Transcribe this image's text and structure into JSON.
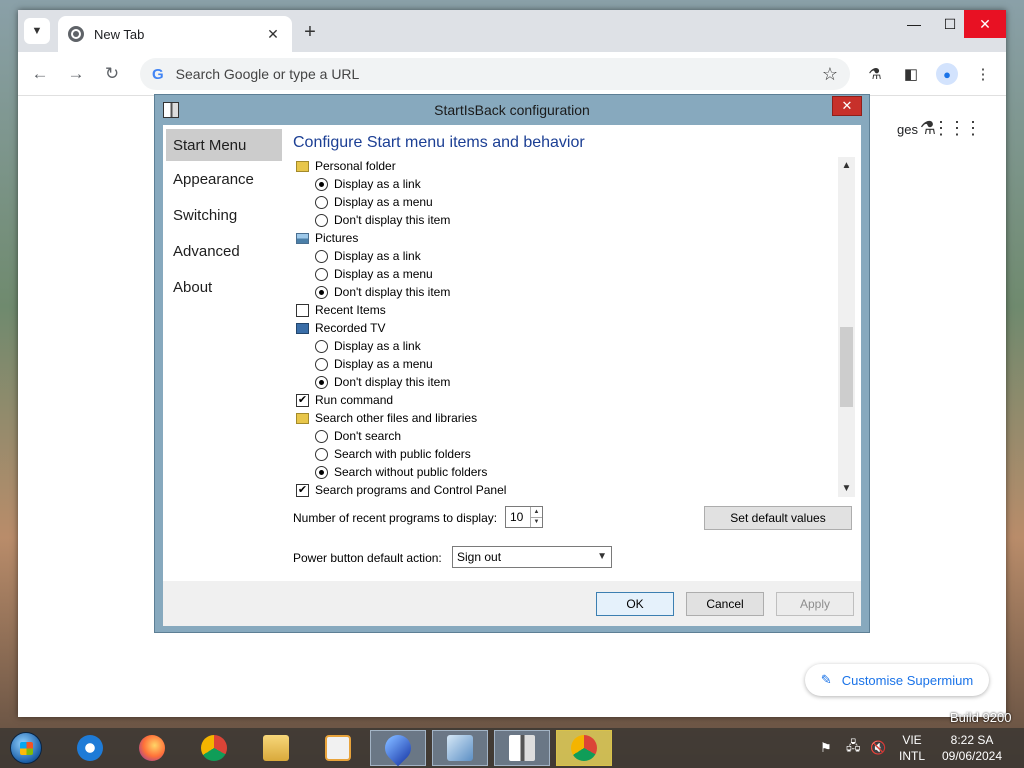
{
  "browser": {
    "tab_title": "New Tab",
    "tab_close": "✕",
    "new_tab": "+",
    "omnibox_placeholder": "Search Google or type a URL",
    "g_logo": "G",
    "ntp_partial_text": "ges",
    "customise_label": "Customise Supermium",
    "window_controls": {
      "minimize": "—",
      "maximize": "☐",
      "close": "✕"
    }
  },
  "dialog": {
    "title": "StartIsBack configuration",
    "close": "✕",
    "nav": [
      "Start Menu",
      "Appearance",
      "Switching",
      "Advanced",
      "About"
    ],
    "active_nav": 0,
    "heading": "Configure Start menu items and behavior",
    "items": [
      {
        "kind": "head",
        "icon": "person-folder-icon",
        "label": "Personal folder"
      },
      {
        "kind": "radio",
        "checked": true,
        "label": "Display as a link"
      },
      {
        "kind": "radio",
        "checked": false,
        "label": "Display as a menu"
      },
      {
        "kind": "radio",
        "checked": false,
        "label": "Don't display this item"
      },
      {
        "kind": "head",
        "icon": "pictures-icon",
        "label": "Pictures"
      },
      {
        "kind": "radio",
        "checked": false,
        "label": "Display as a link"
      },
      {
        "kind": "radio",
        "checked": false,
        "label": "Display as a menu"
      },
      {
        "kind": "radio",
        "checked": true,
        "label": "Don't display this item"
      },
      {
        "kind": "check",
        "checked": false,
        "label": "Recent Items"
      },
      {
        "kind": "head",
        "icon": "tv-icon",
        "label": "Recorded TV"
      },
      {
        "kind": "radio",
        "checked": false,
        "label": "Display as a link"
      },
      {
        "kind": "radio",
        "checked": false,
        "label": "Display as a menu"
      },
      {
        "kind": "radio",
        "checked": true,
        "label": "Don't display this item"
      },
      {
        "kind": "check",
        "checked": true,
        "label": "Run command"
      },
      {
        "kind": "head",
        "icon": "search-folder-icon",
        "label": "Search other files and libraries"
      },
      {
        "kind": "radio",
        "checked": false,
        "label": "Don't search"
      },
      {
        "kind": "radio",
        "checked": false,
        "label": "Search with public folders"
      },
      {
        "kind": "radio",
        "checked": true,
        "label": "Search without public folders"
      },
      {
        "kind": "check",
        "checked": true,
        "label": "Search programs and Control Panel"
      }
    ],
    "recent_label": "Number of recent programs to display:",
    "recent_value": "10",
    "set_default_label": "Set default values",
    "power_label": "Power button default action:",
    "power_value": "Sign out",
    "ok_label": "OK",
    "cancel_label": "Cancel",
    "apply_label": "Apply"
  },
  "taskbar": {
    "lang_top": "VIE",
    "lang_bottom": "INTL",
    "time": "8:22 SA",
    "date": "09/06/2024"
  },
  "desktop": {
    "build_text": "Build 9200"
  },
  "colors": {
    "dialog_frame": "#87a9be",
    "heading_blue": "#1c3f94",
    "close_red": "#c7302a",
    "link_blue": "#1a73e8"
  }
}
